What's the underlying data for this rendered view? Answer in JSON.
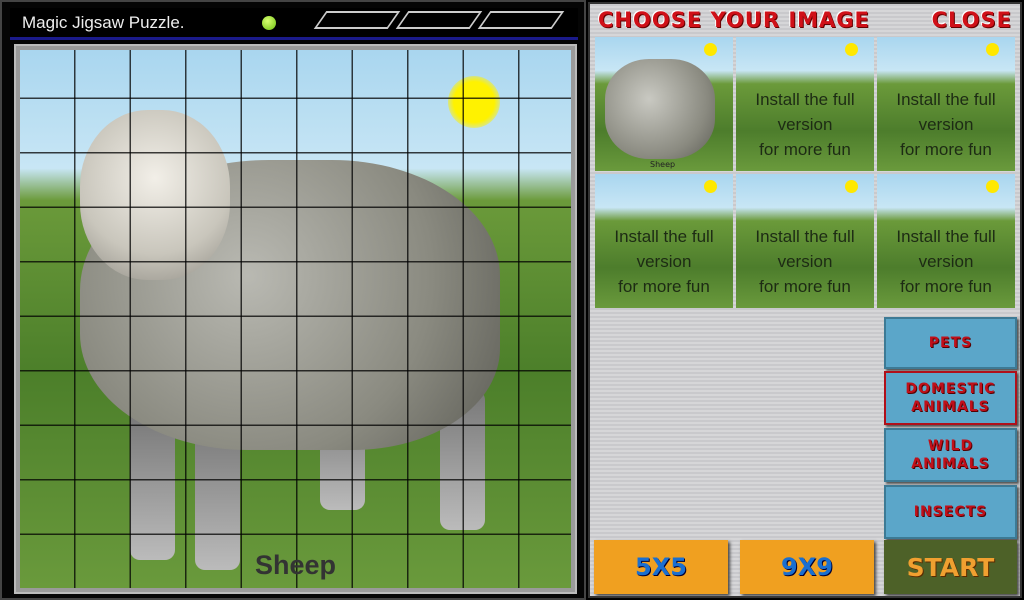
{
  "window": {
    "title": "Magic Jigsaw Puzzle.",
    "status_color": "#7cd41c"
  },
  "puzzle": {
    "caption": "Sheep"
  },
  "chooser": {
    "heading": "CHOOSE YOUR IMAGE",
    "close_label": "CLOSE",
    "thumbnails": [
      {
        "caption": "Sheep",
        "locked": false
      },
      {
        "message": [
          "Install the full",
          "version",
          "for more fun"
        ],
        "locked": true
      },
      {
        "message": [
          "Install the full",
          "version",
          "for more fun"
        ],
        "locked": true
      },
      {
        "message": [
          "Install the full",
          "version",
          "for more fun"
        ],
        "locked": true
      },
      {
        "message": [
          "Install the full",
          "version",
          "for more fun"
        ],
        "locked": true
      },
      {
        "message": [
          "Install the full",
          "version",
          "for more fun"
        ],
        "locked": true
      }
    ]
  },
  "categories": [
    {
      "label": "PETS",
      "selected": false
    },
    {
      "label": "DOMESTIC ANIMALS",
      "selected": true
    },
    {
      "label": "WILD ANIMALS",
      "selected": false
    },
    {
      "label": "INSECTS",
      "selected": false
    }
  ],
  "controls": {
    "size_5": "5X5",
    "size_9": "9X9",
    "start": "START"
  }
}
